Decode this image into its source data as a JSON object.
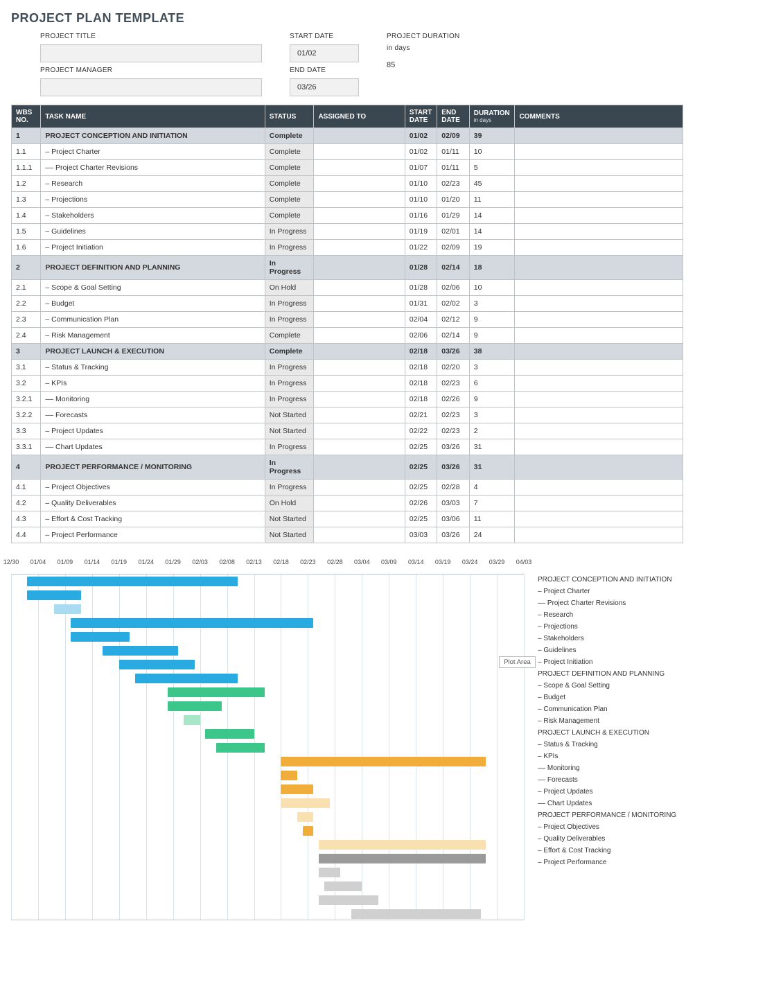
{
  "page_title": "PROJECT PLAN TEMPLATE",
  "meta": {
    "project_title_label": "PROJECT TITLE",
    "project_title": "",
    "project_manager_label": "PROJECT MANAGER",
    "project_manager": "",
    "start_date_label": "START DATE",
    "start_date": "01/02",
    "end_date_label": "END DATE",
    "end_date": "03/26",
    "duration_label": "PROJECT DURATION",
    "duration_unit": "in days",
    "duration": "85"
  },
  "columns": {
    "wbs": "WBS NO.",
    "task": "TASK NAME",
    "status": "STATUS",
    "assigned": "ASSIGNED TO",
    "start": "START DATE",
    "end": "END DATE",
    "dur": "DURATION",
    "dur_sub": "in days",
    "comments": "COMMENTS"
  },
  "rows": [
    {
      "wbs": "1",
      "task": "PROJECT CONCEPTION AND INITIATION",
      "status": "Complete",
      "assigned": "",
      "start": "01/02",
      "end": "02/09",
      "dur": "39",
      "comments": "",
      "phase": true
    },
    {
      "wbs": "1.1",
      "task": "– Project Charter",
      "status": "Complete",
      "assigned": "",
      "start": "01/02",
      "end": "01/11",
      "dur": "10",
      "comments": "",
      "indent": 1
    },
    {
      "wbs": "1.1.1",
      "task": "–– Project Charter Revisions",
      "status": "Complete",
      "assigned": "",
      "start": "01/07",
      "end": "01/11",
      "dur": "5",
      "comments": "",
      "indent": 2
    },
    {
      "wbs": "1.2",
      "task": "– Research",
      "status": "Complete",
      "assigned": "",
      "start": "01/10",
      "end": "02/23",
      "dur": "45",
      "comments": "",
      "indent": 1
    },
    {
      "wbs": "1.3",
      "task": "– Projections",
      "status": "Complete",
      "assigned": "",
      "start": "01/10",
      "end": "01/20",
      "dur": "11",
      "comments": "",
      "indent": 1
    },
    {
      "wbs": "1.4",
      "task": "– Stakeholders",
      "status": "Complete",
      "assigned": "",
      "start": "01/16",
      "end": "01/29",
      "dur": "14",
      "comments": "",
      "indent": 1
    },
    {
      "wbs": "1.5",
      "task": "– Guidelines",
      "status": "In Progress",
      "assigned": "",
      "start": "01/19",
      "end": "02/01",
      "dur": "14",
      "comments": "",
      "indent": 1
    },
    {
      "wbs": "1.6",
      "task": "– Project Initiation",
      "status": "In Progress",
      "assigned": "",
      "start": "01/22",
      "end": "02/09",
      "dur": "19",
      "comments": "",
      "indent": 1
    },
    {
      "wbs": "2",
      "task": "PROJECT DEFINITION AND PLANNING",
      "status": "In Progress",
      "assigned": "",
      "start": "01/28",
      "end": "02/14",
      "dur": "18",
      "comments": "",
      "phase": true
    },
    {
      "wbs": "2.1",
      "task": "– Scope & Goal Setting",
      "status": "On Hold",
      "assigned": "",
      "start": "01/28",
      "end": "02/06",
      "dur": "10",
      "comments": "",
      "indent": 1
    },
    {
      "wbs": "2.2",
      "task": "– Budget",
      "status": "In Progress",
      "assigned": "",
      "start": "01/31",
      "end": "02/02",
      "dur": "3",
      "comments": "",
      "indent": 1
    },
    {
      "wbs": "2.3",
      "task": "– Communication Plan",
      "status": "In Progress",
      "assigned": "",
      "start": "02/04",
      "end": "02/12",
      "dur": "9",
      "comments": "",
      "indent": 1
    },
    {
      "wbs": "2.4",
      "task": "– Risk Management",
      "status": "Complete",
      "assigned": "",
      "start": "02/06",
      "end": "02/14",
      "dur": "9",
      "comments": "",
      "indent": 1
    },
    {
      "wbs": "3",
      "task": "PROJECT LAUNCH & EXECUTION",
      "status": "Complete",
      "assigned": "",
      "start": "02/18",
      "end": "03/26",
      "dur": "38",
      "comments": "",
      "phase": true
    },
    {
      "wbs": "3.1",
      "task": "– Status & Tracking",
      "status": "In Progress",
      "assigned": "",
      "start": "02/18",
      "end": "02/20",
      "dur": "3",
      "comments": "",
      "indent": 1
    },
    {
      "wbs": "3.2",
      "task": "– KPIs",
      "status": "In Progress",
      "assigned": "",
      "start": "02/18",
      "end": "02/23",
      "dur": "6",
      "comments": "",
      "indent": 1
    },
    {
      "wbs": "3.2.1",
      "task": "–– Monitoring",
      "status": "In Progress",
      "assigned": "",
      "start": "02/18",
      "end": "02/26",
      "dur": "9",
      "comments": "",
      "indent": 2
    },
    {
      "wbs": "3.2.2",
      "task": "–– Forecasts",
      "status": "Not Started",
      "assigned": "",
      "start": "02/21",
      "end": "02/23",
      "dur": "3",
      "comments": "",
      "indent": 2
    },
    {
      "wbs": "3.3",
      "task": "– Project Updates",
      "status": "Not Started",
      "assigned": "",
      "start": "02/22",
      "end": "02/23",
      "dur": "2",
      "comments": "",
      "indent": 1
    },
    {
      "wbs": "3.3.1",
      "task": "–– Chart Updates",
      "status": "In Progress",
      "assigned": "",
      "start": "02/25",
      "end": "03/26",
      "dur": "31",
      "comments": "",
      "indent": 2
    },
    {
      "wbs": "4",
      "task": "PROJECT PERFORMANCE / MONITORING",
      "status": "In Progress",
      "assigned": "",
      "start": "02/25",
      "end": "03/26",
      "dur": "31",
      "comments": "",
      "phase": true
    },
    {
      "wbs": "4.1",
      "task": "– Project Objectives",
      "status": "In Progress",
      "assigned": "",
      "start": "02/25",
      "end": "02/28",
      "dur": "4",
      "comments": "",
      "indent": 1
    },
    {
      "wbs": "4.2",
      "task": "– Quality Deliverables",
      "status": "On Hold",
      "assigned": "",
      "start": "02/26",
      "end": "03/03",
      "dur": "7",
      "comments": "",
      "indent": 1
    },
    {
      "wbs": "4.3",
      "task": "– Effort & Cost Tracking",
      "status": "Not Started",
      "assigned": "",
      "start": "02/25",
      "end": "03/06",
      "dur": "11",
      "comments": "",
      "indent": 1
    },
    {
      "wbs": "4.4",
      "task": "– Project Performance",
      "status": "Not Started",
      "assigned": "",
      "start": "03/03",
      "end": "03/26",
      "dur": "24",
      "comments": "",
      "indent": 1
    }
  ],
  "chart_data": {
    "type": "bar",
    "orientation": "horizontal-gantt",
    "x_ticks": [
      "12/30",
      "01/04",
      "01/09",
      "01/14",
      "01/19",
      "01/24",
      "01/29",
      "02/03",
      "02/08",
      "02/13",
      "02/18",
      "02/23",
      "02/28",
      "03/04",
      "03/09",
      "03/14",
      "03/19",
      "03/24",
      "03/29",
      "04/03"
    ],
    "x_origin_serial": 0,
    "x_max_serial": 95,
    "tooltip": {
      "text": "Plot Area",
      "row_index": 6,
      "x_serial": 75
    },
    "colors": {
      "g1": "#29abe2",
      "g1l": "#a9dbf2",
      "g2": "#3cc68a",
      "g2l": "#a7e6c9",
      "g3": "#f0ad3a",
      "g3l": "#f9e0b0",
      "g4": "#9a9a9a",
      "g4l": "#d0d0d0"
    },
    "series": [
      {
        "name": "PROJECT CONCEPTION AND INITIATION",
        "start": 3,
        "dur": 39,
        "color": "g1"
      },
      {
        "name": "– Project Charter",
        "start": 3,
        "dur": 10,
        "color": "g1"
      },
      {
        "name": "–– Project Charter Revisions",
        "start": 8,
        "dur": 5,
        "color": "g1l"
      },
      {
        "name": "– Research",
        "start": 11,
        "dur": 45,
        "color": "g1"
      },
      {
        "name": "– Projections",
        "start": 11,
        "dur": 11,
        "color": "g1"
      },
      {
        "name": "– Stakeholders",
        "start": 17,
        "dur": 14,
        "color": "g1"
      },
      {
        "name": "– Guidelines",
        "start": 20,
        "dur": 14,
        "color": "g1"
      },
      {
        "name": "– Project Initiation",
        "start": 23,
        "dur": 19,
        "color": "g1"
      },
      {
        "name": "PROJECT DEFINITION AND PLANNING",
        "start": 29,
        "dur": 18,
        "color": "g2"
      },
      {
        "name": "– Scope & Goal Setting",
        "start": 29,
        "dur": 10,
        "color": "g2"
      },
      {
        "name": "– Budget",
        "start": 32,
        "dur": 3,
        "color": "g2l"
      },
      {
        "name": "– Communication Plan",
        "start": 36,
        "dur": 9,
        "color": "g2"
      },
      {
        "name": "– Risk Management",
        "start": 38,
        "dur": 9,
        "color": "g2"
      },
      {
        "name": "PROJECT LAUNCH & EXECUTION",
        "start": 50,
        "dur": 38,
        "color": "g3"
      },
      {
        "name": "– Status & Tracking",
        "start": 50,
        "dur": 3,
        "color": "g3"
      },
      {
        "name": "– KPIs",
        "start": 50,
        "dur": 6,
        "color": "g3"
      },
      {
        "name": "–– Monitoring",
        "start": 50,
        "dur": 9,
        "color": "g3l"
      },
      {
        "name": "–– Forecasts",
        "start": 53,
        "dur": 3,
        "color": "g3l"
      },
      {
        "name": "– Project Updates",
        "start": 54,
        "dur": 2,
        "color": "g3"
      },
      {
        "name": "–– Chart Updates",
        "start": 57,
        "dur": 31,
        "color": "g3l"
      },
      {
        "name": "PROJECT PERFORMANCE / MONITORING",
        "start": 57,
        "dur": 31,
        "color": "g4"
      },
      {
        "name": "– Project Objectives",
        "start": 57,
        "dur": 4,
        "color": "g4l"
      },
      {
        "name": "– Quality Deliverables",
        "start": 58,
        "dur": 7,
        "color": "g4l"
      },
      {
        "name": "– Effort & Cost Tracking",
        "start": 57,
        "dur": 11,
        "color": "g4l"
      },
      {
        "name": "– Project Performance",
        "start": 63,
        "dur": 24,
        "color": "g4l"
      }
    ]
  }
}
